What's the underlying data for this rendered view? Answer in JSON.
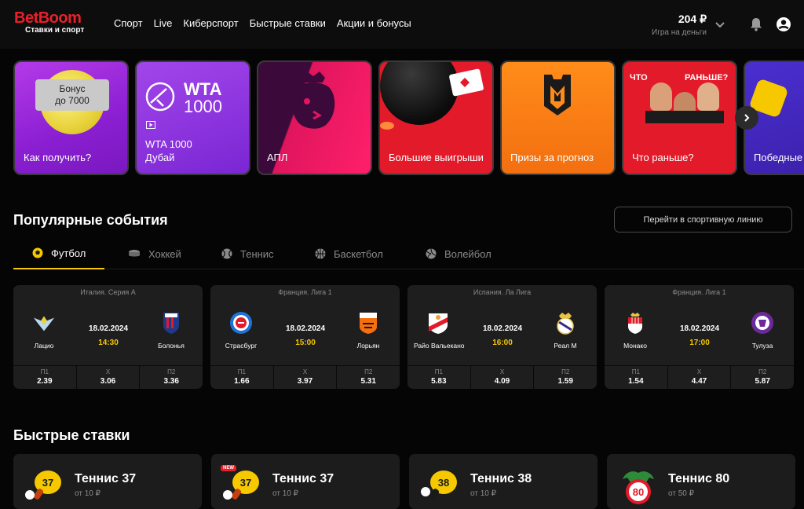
{
  "header": {
    "logo_main": "BetBoom",
    "logo_sub": "Ставки и спорт",
    "nav": [
      "Спорт",
      "Live",
      "Киберспорт",
      "Быстрые ставки",
      "Акции и бонусы"
    ],
    "balance": "204 ₽",
    "balance_label": "Игра на деньги"
  },
  "promos": [
    {
      "label": "Как получить?",
      "badge_line1": "Бонус",
      "badge_line2": "до 7000"
    },
    {
      "label_line1": "WTA 1000",
      "label_line2": "Дубай",
      "logo_top": "WTA",
      "logo_bottom": "1000"
    },
    {
      "label": "АПЛ"
    },
    {
      "label": "Большие выигрыши"
    },
    {
      "label": "Призы за прогноз"
    },
    {
      "label": "Что раньше?",
      "art_left": "ЧТО",
      "art_right": "РАНЬШЕ?"
    },
    {
      "label": "Победные"
    }
  ],
  "popular": {
    "title": "Популярные события",
    "sport_line_button": "Перейти в спортивную линию",
    "tabs": [
      "Футбол",
      "Хоккей",
      "Теннис",
      "Баскетбол",
      "Волейбол"
    ],
    "active_tab": "Футбол",
    "events": [
      {
        "league": "Италия. Серия А",
        "team1": "Лацио",
        "team2": "Болонья",
        "date": "18.02.2024",
        "time": "14:30",
        "odds": [
          {
            "label": "П1",
            "value": "2.39"
          },
          {
            "label": "Х",
            "value": "3.06"
          },
          {
            "label": "П2",
            "value": "3.36"
          }
        ]
      },
      {
        "league": "Франция. Лига 1",
        "team1": "Страсбург",
        "team2": "Лорьян",
        "date": "18.02.2024",
        "time": "15:00",
        "odds": [
          {
            "label": "П1",
            "value": "1.66"
          },
          {
            "label": "Х",
            "value": "3.97"
          },
          {
            "label": "П2",
            "value": "5.31"
          }
        ]
      },
      {
        "league": "Испания. Ла Лига",
        "team1": "Райо Вальекано",
        "team2": "Реал М",
        "date": "18.02.2024",
        "time": "16:00",
        "odds": [
          {
            "label": "П1",
            "value": "5.83"
          },
          {
            "label": "Х",
            "value": "4.09"
          },
          {
            "label": "П2",
            "value": "1.59"
          }
        ]
      },
      {
        "league": "Франция. Лига 1",
        "team1": "Монако",
        "team2": "Тулуза",
        "date": "18.02.2024",
        "time": "17:00",
        "odds": [
          {
            "label": "П1",
            "value": "1.54"
          },
          {
            "label": "Х",
            "value": "4.47"
          },
          {
            "label": "П2",
            "value": "5.87"
          }
        ]
      }
    ]
  },
  "quick_bets": {
    "title": "Быстрые ставки",
    "items": [
      {
        "title": "Теннис 37",
        "price": "от 10 ₽",
        "icon_num": "37"
      },
      {
        "title": "Теннис 37",
        "price": "от 10 ₽",
        "icon_num": "37",
        "badge": "NEW"
      },
      {
        "title": "Теннис 38",
        "price": "от 10 ₽",
        "icon_num": "38"
      },
      {
        "title": "Теннис 80",
        "price": "от 50 ₽",
        "icon_num": "80"
      }
    ]
  },
  "colors": {
    "accent": "#f5c800",
    "brand": "#e8202a",
    "card_bg": "#1e1e1e"
  }
}
